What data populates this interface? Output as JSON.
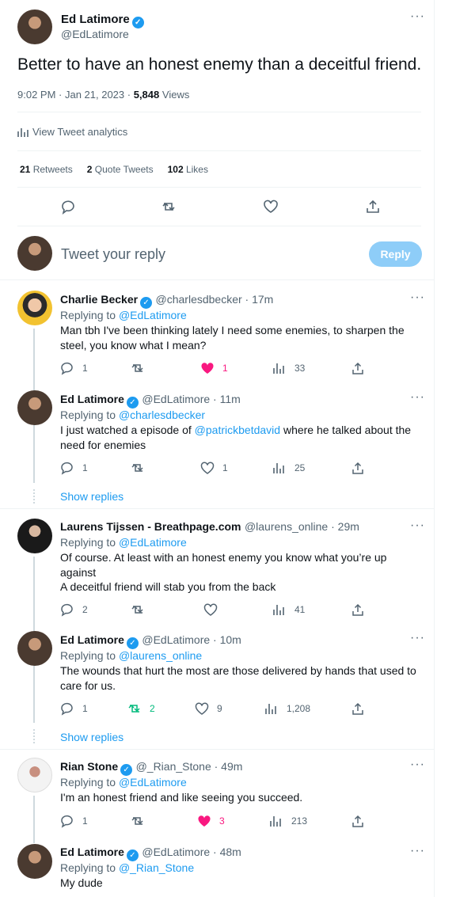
{
  "main_tweet": {
    "name": "Ed Latimore",
    "handle": "@EdLatimore",
    "text": "Better to have an honest enemy than a deceitful friend.",
    "time": "9:02 PM · Jan 21, 2023 ·",
    "views_count": "5,848",
    "views_label": "Views",
    "analytics": "View Tweet analytics",
    "retweets_count": "21",
    "retweets_label": "Retweets",
    "quotes_count": "2",
    "quotes_label": "Quote Tweets",
    "likes_count": "102",
    "likes_label": "Likes"
  },
  "composer": {
    "placeholder": "Tweet your reply",
    "button": "Reply"
  },
  "replying_label": "Replying to",
  "show_replies": "Show replies",
  "replies": [
    {
      "name": "Charlie Becker",
      "handle": "@charlesdbecker · 17m",
      "to": "@EdLatimore",
      "text": "Man tbh I've been thinking lately I need some enemies, to sharpen the steel, you know what I mean?",
      "reply": "1",
      "retweet": "",
      "like": "1",
      "views": "33"
    },
    {
      "name": "Ed Latimore",
      "handle": "@EdLatimore · 11m",
      "to": "@charlesdbecker",
      "text_pre": "I just watched a episode of ",
      "text_link": "@patrickbetdavid",
      "text_post": " where he talked about the need for enemies",
      "reply": "1",
      "retweet": "",
      "like": "1",
      "views": "25"
    },
    {
      "name": "Laurens Tijssen - Breathpage.com",
      "handle": "@laurens_online · 29m",
      "to": "@EdLatimore",
      "text": "Of course. At least with an honest enemy you know what you’re up against",
      "text2": "A deceitful friend will stab you from the back",
      "reply": "2",
      "retweet": "",
      "like": "",
      "views": "41"
    },
    {
      "name": "Ed Latimore",
      "handle": "@EdLatimore · 10m",
      "to": "@laurens_online",
      "text": "The wounds that hurt the most are those delivered by hands that used to care for us.",
      "reply": "1",
      "retweet": "2",
      "like": "9",
      "views": "1,208"
    },
    {
      "name": "Rian Stone",
      "handle": "@_Rian_Stone · 49m",
      "to": "@EdLatimore",
      "text": "I'm an honest friend and like seeing you succeed.",
      "reply": "1",
      "retweet": "",
      "like": "3",
      "views": "213"
    },
    {
      "name": "Ed Latimore",
      "handle": "@EdLatimore · 48m",
      "to": "@_Rian_Stone",
      "text": "My dude"
    }
  ],
  "colors": {
    "accent": "#1d9bf0",
    "like": "#f91880",
    "retweet": "#00ba7c",
    "muted": "#536471"
  }
}
